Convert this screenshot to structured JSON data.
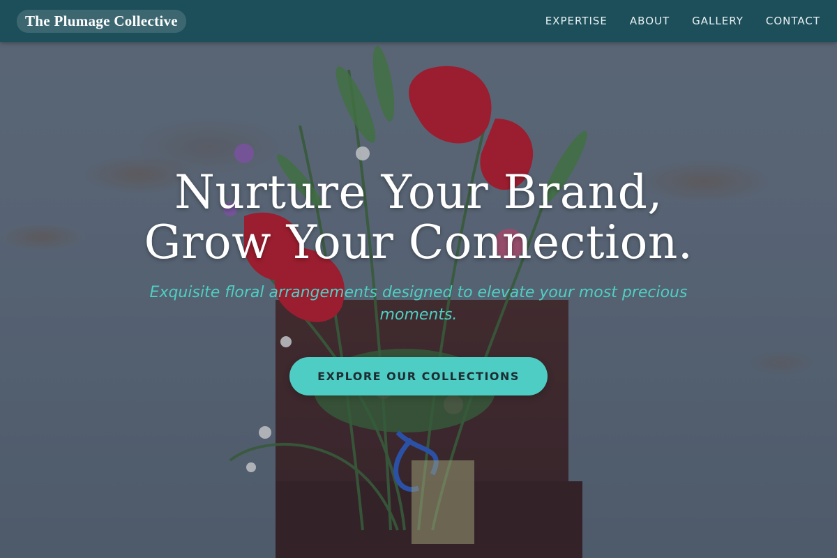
{
  "navbar": {
    "brand": "The Plumage Collective",
    "links": [
      "EXPERTISE",
      "ABOUT",
      "GALLERY",
      "CONTACT"
    ]
  },
  "hero": {
    "title_line_1": "Nurture Your Brand,",
    "title_line_2": "Grow Your Connection.",
    "subtitle": "Exquisite floral arrangements designed to elevate your most precious moments.",
    "cta_label": "EXPLORE OUR COLLECTIONS",
    "background_image": "floral-bouquet-photo"
  },
  "colors": {
    "navbar_bg": "#1d4f5a",
    "accent": "#4ecdc4",
    "subtitle": "#4fcfc4",
    "title": "#ffffff"
  }
}
